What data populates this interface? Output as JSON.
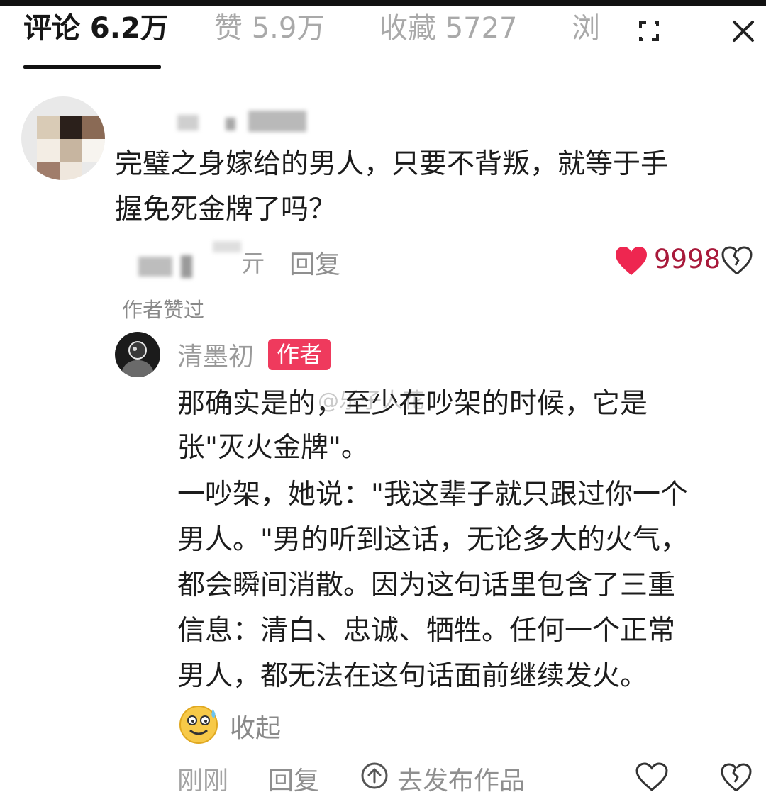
{
  "tabs": [
    {
      "label": "评论 6.2万"
    },
    {
      "label": "赞 5.9万"
    },
    {
      "label": "收藏 5727"
    },
    {
      "label": "浏"
    }
  ],
  "icons": {
    "expand": "expand-icon",
    "close": "close-icon",
    "heart": "heart-icon",
    "broken_heart": "broken-heart-icon",
    "share": "share-up-icon",
    "emoji": "sweat-smile-emoji"
  },
  "colors": {
    "accent": "#ef3a5d",
    "heart": "#ee2650"
  },
  "comment": {
    "lines": [
      "完璧之身嫁给的男人，只要不背叛，就等于手",
      "握免死金牌了吗？"
    ],
    "meta_suffix": "亓",
    "reply_label": "回复",
    "like_count": "9998",
    "author_liked": "作者赞过"
  },
  "reply": {
    "username": "清墨初",
    "badge": "作者",
    "lines": [
      "那确实是的，至少在吵架的时候，它是",
      "张\"灭火金牌\"。",
      "一吵架，她说：\"我这辈子就只跟过你一个",
      "男人。\"男的听到这话，无论多大的火气，",
      "都会瞬间消散。因为这句话里包含了三重",
      "信息：清白、忠诚、牺牲。任何一个正常",
      "男人，都无法在这句话面前继续发火。"
    ],
    "collapse_label": "收起",
    "time": "刚刚",
    "reply_label": "回复",
    "publish_label": "去发布作品"
  },
  "watermark": "@乐子人花"
}
